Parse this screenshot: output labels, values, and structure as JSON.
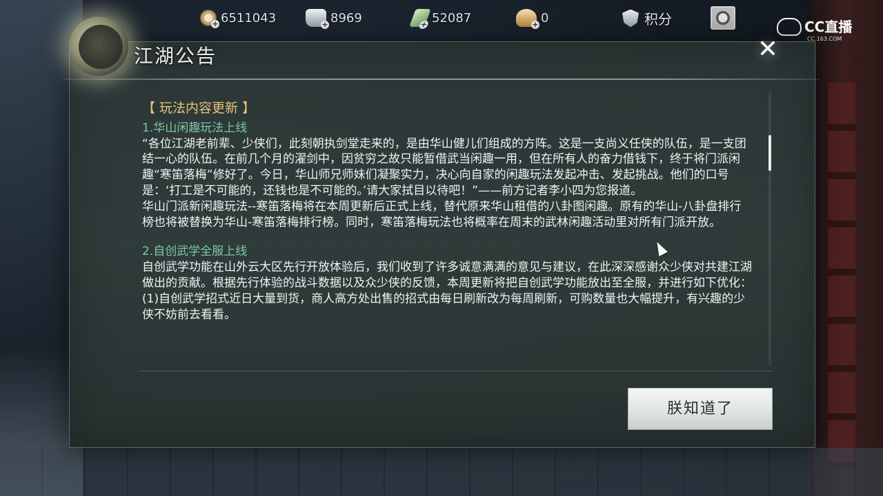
{
  "resources": [
    {
      "icon": "coin-icon",
      "value": "6511043"
    },
    {
      "icon": "silver-icon",
      "value": "8969"
    },
    {
      "icon": "jade-icon",
      "value": "52087"
    },
    {
      "icon": "ingot-icon",
      "value": "0"
    }
  ],
  "points_label": "积分",
  "watermark": {
    "brand": "CC直播",
    "url": "CC.163.COM"
  },
  "notice": {
    "title": "江湖公告",
    "section_title": "【 玩法内容更新 】",
    "item1_title": "1.华山闲趣玩法上线",
    "item1_para1": "“各位江湖老前辈、少侠们，此刻朝执剑堂走来的，是由华山健儿们组成的方阵。这是一支尚义任侠的队伍，是一支团结一心的队伍。在前几个月的濯剑中，因贫穷之故只能暂借武当闲趣一用，但在所有人的奋力借钱下，终于将门派闲趣“寒笛落梅”修好了。今日，华山师兄师妹们凝聚实力，决心向自家的闲趣玩法发起冲击、发起挑战。他们的口号是：‘打工是不可能的，还钱也是不可能的。’请大家拭目以待吧！”——前方记者李小四为您报道。",
    "item1_para2": "华山门派新闲趣玩法--寒笛落梅将在本周更新后正式上线，替代原来华山租借的八卦图闲趣。原有的华山-八卦盘排行榜也将被替换为华山-寒笛落梅排行榜。同时，寒笛落梅玩法也将概率在周末的武林闲趣活动里对所有门派开放。",
    "item2_title": "2.自创武学全服上线",
    "item2_para1": "自创武学功能在山外云大区先行开放体验后，我们收到了许多诚意满满的意见与建议，在此深深感谢众少侠对共建江湖做出的贡献。根据先行体验的战斗数据以及众少侠的反馈，本周更新将把自创武学功能放出至全服，并进行如下优化：",
    "item2_para2": "(1)自创武学招式近日大量到货，商人高方处出售的招式由每日刷新改为每周刷新，可购数量也大幅提升，有兴趣的少侠不妨前去看看。"
  },
  "ok_button": "朕知道了"
}
